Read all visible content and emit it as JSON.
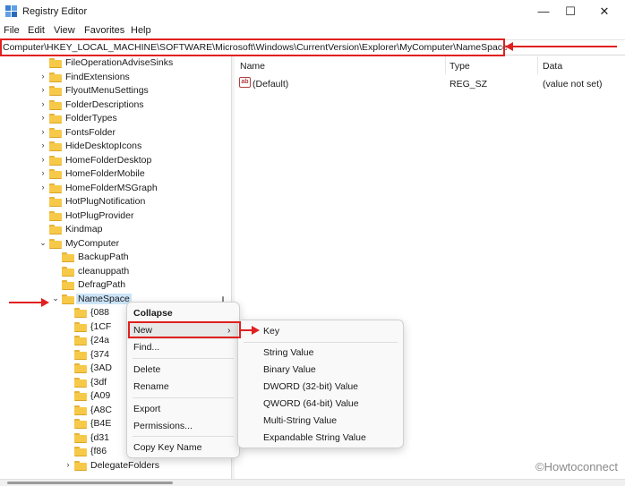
{
  "window": {
    "title": "Registry Editor",
    "minimize": "—",
    "maximize": "☐",
    "close": "✕"
  },
  "menubar": {
    "items": [
      "File",
      "Edit",
      "View",
      "Favorites",
      "Help"
    ]
  },
  "address": {
    "path": "Computer\\HKEY_LOCAL_MACHINE\\SOFTWARE\\Microsoft\\Windows\\CurrentVersion\\Explorer\\MyComputer\\NameSpace"
  },
  "tree": {
    "items": [
      {
        "label": "FileOperationAdviseSinks",
        "level": 1,
        "expander": ""
      },
      {
        "label": "FindExtensions",
        "level": 1,
        "expander": "›"
      },
      {
        "label": "FlyoutMenuSettings",
        "level": 1,
        "expander": "›"
      },
      {
        "label": "FolderDescriptions",
        "level": 1,
        "expander": "›"
      },
      {
        "label": "FolderTypes",
        "level": 1,
        "expander": "›"
      },
      {
        "label": "FontsFolder",
        "level": 1,
        "expander": "›"
      },
      {
        "label": "HideDesktopIcons",
        "level": 1,
        "expander": "›"
      },
      {
        "label": "HomeFolderDesktop",
        "level": 1,
        "expander": "›"
      },
      {
        "label": "HomeFolderMobile",
        "level": 1,
        "expander": "›"
      },
      {
        "label": "HomeFolderMSGraph",
        "level": 1,
        "expander": "›"
      },
      {
        "label": "HotPlugNotification",
        "level": 1,
        "expander": ""
      },
      {
        "label": "HotPlugProvider",
        "level": 1,
        "expander": ""
      },
      {
        "label": "Kindmap",
        "level": 1,
        "expander": ""
      },
      {
        "label": "MyComputer",
        "level": 1,
        "expander": "⌄"
      },
      {
        "label": "BackupPath",
        "level": 2,
        "expander": ""
      },
      {
        "label": "cleanuppath",
        "level": 2,
        "expander": ""
      },
      {
        "label": "DefragPath",
        "level": 2,
        "expander": ""
      },
      {
        "label": "NameSpace",
        "level": 2,
        "expander": "⌄",
        "selected": true
      },
      {
        "label": "{088",
        "level": 3,
        "expander": ""
      },
      {
        "label": "{1CF",
        "level": 3,
        "expander": ""
      },
      {
        "label": "{24a",
        "level": 3,
        "expander": ""
      },
      {
        "label": "{374",
        "level": 3,
        "expander": ""
      },
      {
        "label": "{3AD",
        "level": 3,
        "expander": ""
      },
      {
        "label": "{3df",
        "level": 3,
        "expander": ""
      },
      {
        "label": "{A09",
        "level": 3,
        "expander": ""
      },
      {
        "label": "{A8C",
        "level": 3,
        "expander": ""
      },
      {
        "label": "{B4E",
        "level": 3,
        "expander": ""
      },
      {
        "label": "{d31",
        "level": 3,
        "expander": ""
      },
      {
        "label": "{f86",
        "level": 3,
        "expander": ""
      },
      {
        "label": "DelegateFolders",
        "level": 3,
        "expander": "›"
      }
    ]
  },
  "list": {
    "columns": [
      "Name",
      "Type",
      "Data"
    ],
    "rows": [
      {
        "name": "(Default)",
        "type": "REG_SZ",
        "data": "(value not set)",
        "icon": "ab"
      }
    ]
  },
  "context_menu": {
    "items": [
      "Collapse",
      "New",
      "Find...",
      "Delete",
      "Rename",
      "Export",
      "Permissions...",
      "Copy Key Name"
    ],
    "submenu_arrow": "›"
  },
  "submenu": {
    "items": [
      "Key",
      "String Value",
      "Binary Value",
      "DWORD (32-bit) Value",
      "QWORD (64-bit) Value",
      "Multi-String Value",
      "Expandable String Value"
    ]
  },
  "watermark": "©Howtoconnect",
  "colors": {
    "annotation": "#e02020",
    "folder": "#f7c948",
    "selection": "#cce4f7"
  }
}
